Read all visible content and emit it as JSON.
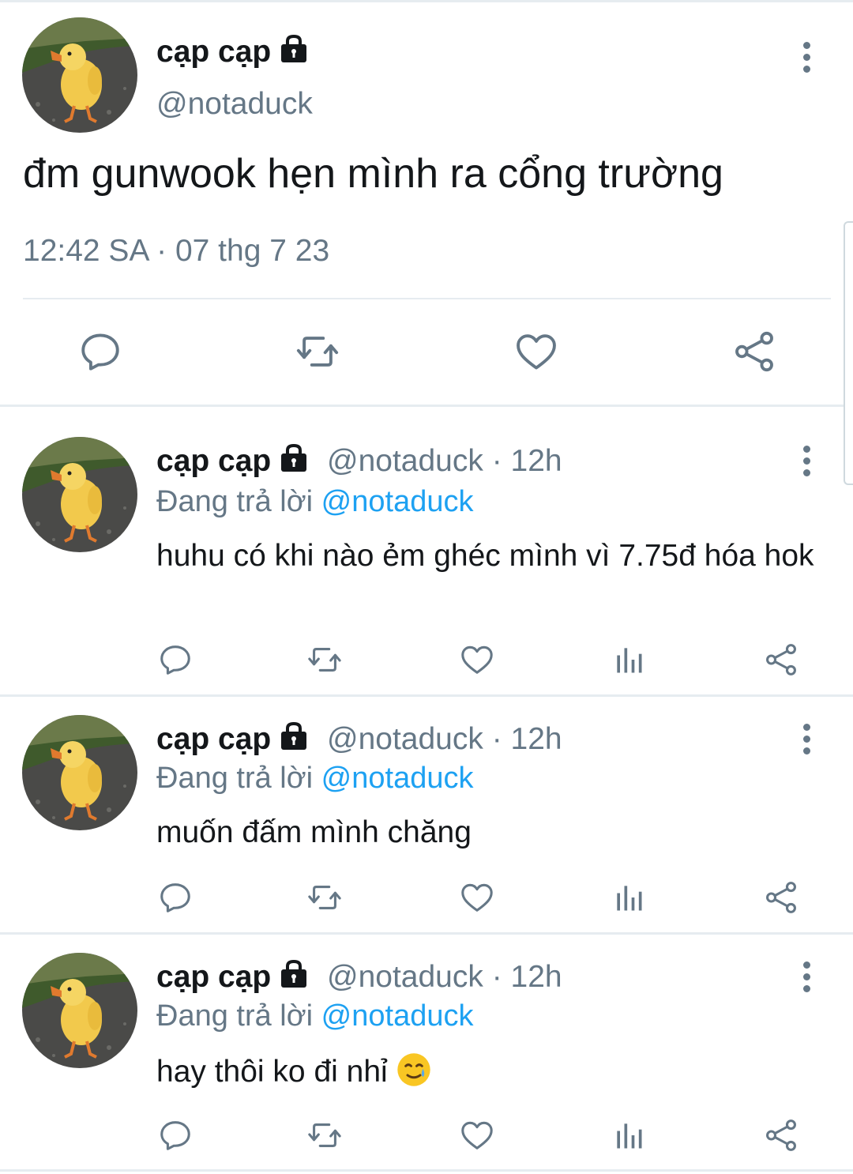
{
  "main_tweet": {
    "display_name": "cạp cạp",
    "handle": "@notaduck",
    "text": "đm gunwook hẹn mình ra cổng trường",
    "timestamp": "12:42 SA · 07 thg 7 23",
    "icons": [
      "lock-icon",
      "more-icon",
      "reply-icon",
      "retweet-icon",
      "like-icon",
      "share-icon"
    ]
  },
  "replies": [
    {
      "display_name": "cạp cạp",
      "handle_time": "@notaduck · 12h",
      "replying_prefix": "Đang trả lời",
      "replying_mention": "@notaduck",
      "text": "huhu có khi nào ẻm ghéc mình vì 7.75đ hóa hok"
    },
    {
      "display_name": "cạp cạp",
      "handle_time": "@notaduck · 12h",
      "replying_prefix": "Đang trả lời",
      "replying_mention": "@notaduck",
      "text": "muốn đấm mình chăng"
    },
    {
      "display_name": "cạp cạp",
      "handle_time": "@notaduck · 12h",
      "replying_prefix": "Đang trả lời",
      "replying_mention": "@notaduck",
      "text": "hay thôi ko đi nhỉ",
      "emoji": "smiling-face-with-tear"
    }
  ],
  "colors": {
    "text": "#14171a",
    "secondary": "#657786",
    "mention": "#1da1f2",
    "divider": "#e6ecf0",
    "duck": "#f2c94c",
    "ground": "#4a4a48"
  }
}
